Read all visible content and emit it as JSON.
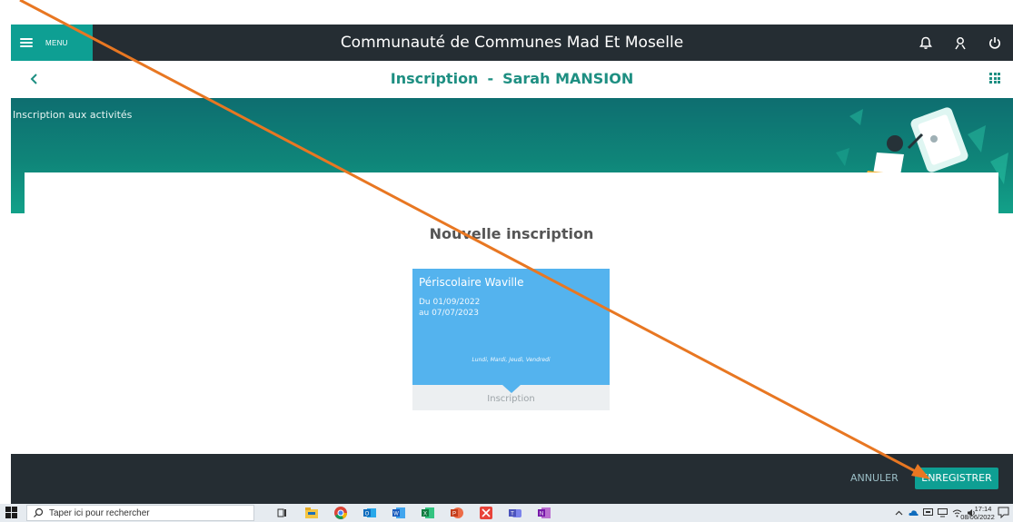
{
  "app": {
    "title": "Communauté de Communes Mad Et Moselle",
    "menu_label": "MENU",
    "header_icons": [
      "bell-icon",
      "user-icon",
      "power-icon"
    ]
  },
  "page": {
    "title_prefix": "Inscription",
    "title_separator": "-",
    "student_name": "Sarah MANSION",
    "banner_label": "Inscription aux activités"
  },
  "section": {
    "title": "Nouvelle inscription"
  },
  "activity": {
    "name": "Périscolaire Waville",
    "from": "Du 01/09/2022",
    "to": "au 07/07/2023",
    "days": "Lundi, Mardi, Jeudi, Vendredi",
    "action_label": "Inscription",
    "color": "#54b3ee"
  },
  "footer": {
    "cancel_label": "ANNULER",
    "save_label": "ENREGISTRER"
  },
  "taskbar": {
    "search_placeholder": "Taper ici pour rechercher",
    "apps": [
      "task-view-icon",
      "file-explorer-icon",
      "chrome-icon",
      "outlook-icon",
      "word-icon",
      "excel-icon",
      "powerpoint-icon",
      "xmind-icon",
      "teams-icon",
      "onenote-icon"
    ],
    "time": "17:14",
    "date": "08/06/2022"
  },
  "colors": {
    "accent": "#0e9f93",
    "header_dark": "#252d33",
    "title_green": "#1e8f82",
    "annotation_arrow": "#e87722"
  }
}
